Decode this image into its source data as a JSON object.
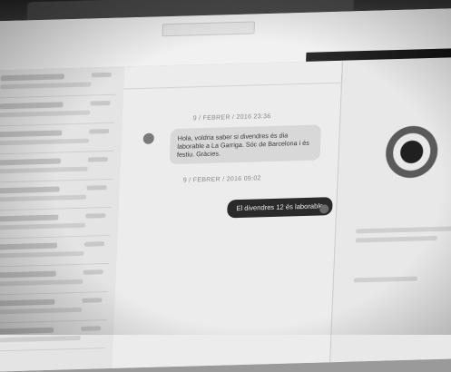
{
  "conversation": {
    "date_1": "9 / FEBRER / 2016 23:36",
    "incoming_message": "Hola, voldria saber si divendres és dia laborable a La Garriga. Sóc de Barcelona i és festiu. Gràcies.",
    "date_2": "9 / FEBRER / 2016 09:02",
    "outgoing_message": "El divendres 12 és laborable"
  }
}
